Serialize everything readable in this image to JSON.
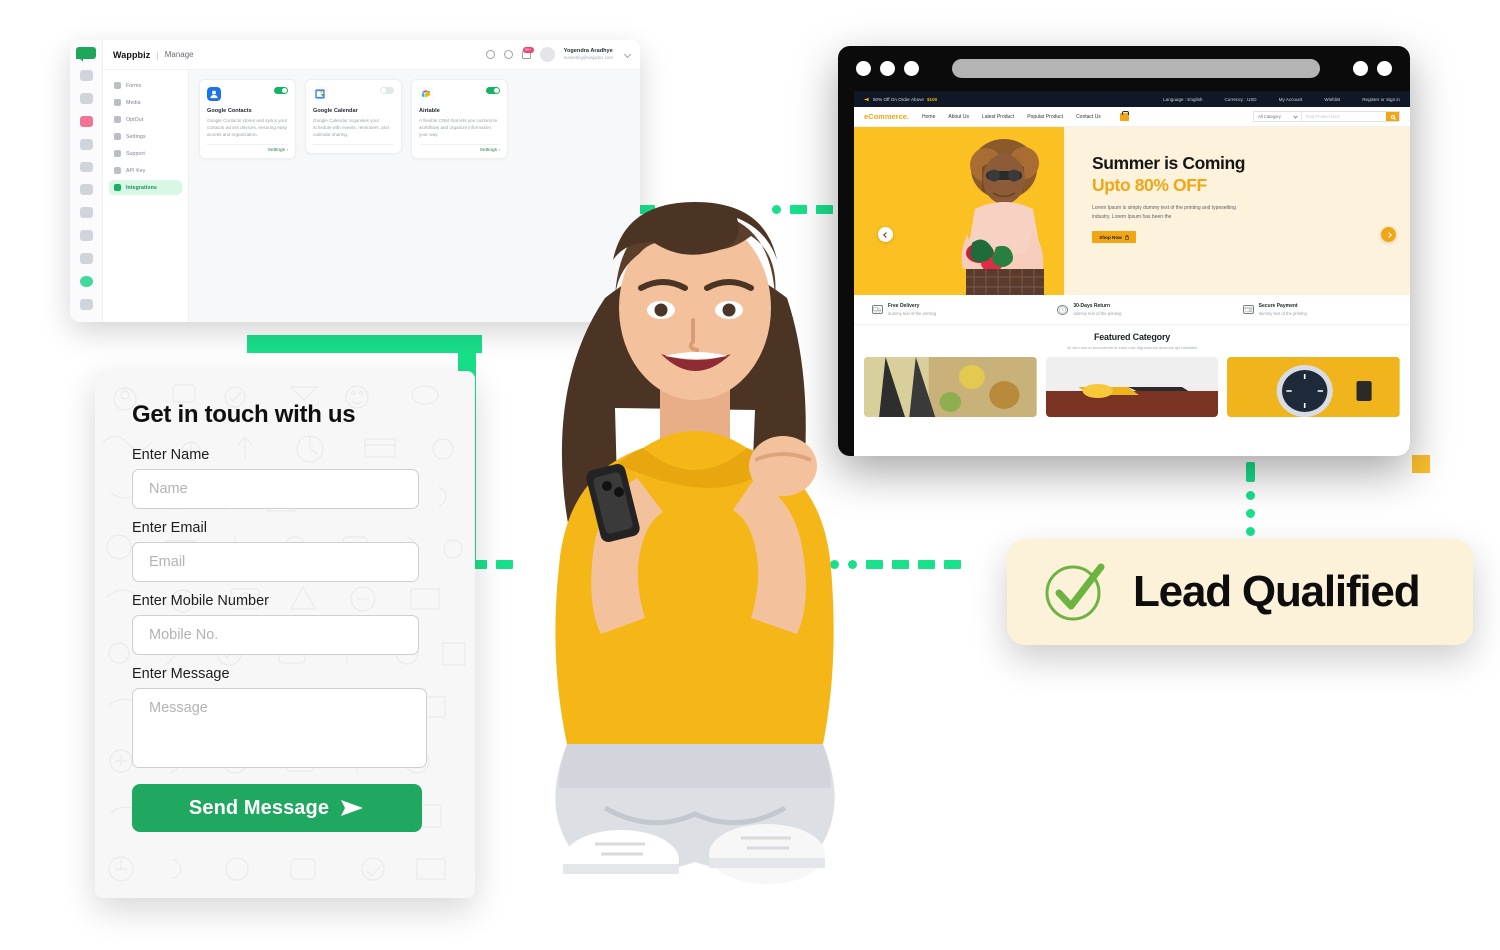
{
  "dashboard": {
    "brand": "Wappbiz",
    "separator": "|",
    "section": "Manage",
    "user": {
      "name": "Yogendra Aradhye",
      "email": "marketing@wappbiz.com",
      "notification_badge": "99+"
    },
    "sidebar": [
      {
        "label": "Forms",
        "active": false
      },
      {
        "label": "Media",
        "active": false
      },
      {
        "label": "OptOut",
        "active": false
      },
      {
        "label": "Settings",
        "active": false
      },
      {
        "label": "Support",
        "active": false
      },
      {
        "label": "API Key",
        "active": false
      },
      {
        "label": "Integrations",
        "active": true
      }
    ],
    "integration_cards": [
      {
        "title": "Google Contacts",
        "description": "Google Contacts stores and syncs your contacts across devices, ensuring easy access and organization.",
        "enabled": true,
        "settings_label": "Settings",
        "icon": "google-contacts-icon"
      },
      {
        "title": "Google Calendar",
        "description": "Google Calendar organises your schedule with events, reminders, and calendar sharing.",
        "enabled": false,
        "settings_label": "",
        "icon": "google-calendar-icon"
      },
      {
        "title": "Airtable",
        "description": "A flexible CRM that lets you customize workflows and organize information your way.",
        "enabled": true,
        "settings_label": "Settings",
        "icon": "airtable-icon"
      }
    ]
  },
  "contact_form": {
    "title": "Get in touch with us",
    "fields": [
      {
        "label": "Enter Name",
        "placeholder": "Name",
        "value": ""
      },
      {
        "label": "Enter Email",
        "placeholder": "Email",
        "value": ""
      },
      {
        "label": "Enter Mobile Number",
        "placeholder": "Mobile No.",
        "value": ""
      }
    ],
    "message": {
      "label": "Enter Message",
      "placeholder": "Message",
      "value": ""
    },
    "submit_label": "Send Message",
    "submit_icon": "send-plane-icon"
  },
  "ecommerce": {
    "topbar": {
      "promo": "50% Off On Order Above",
      "promo_amount": "$100",
      "language": "Language : English",
      "currency": "Currency : USD",
      "account": "My Account",
      "wishlist": "Wishlist",
      "signin": "Register or Sign in"
    },
    "nav": {
      "logo": "eCommerce.",
      "items": [
        "Home",
        "About Us",
        "Latest Product",
        "Popular Product",
        "Contact Us"
      ],
      "category_select": "All Category",
      "search_placeholder": "Find Product Here"
    },
    "hero": {
      "line1": "Summer is Coming",
      "line2": "Upto 80% OFF",
      "paragraph": "Lorem Ipsum is simply dummy text of the printing and typesetting industry. Lorem Ipsum has been the",
      "cta": "Shop Now"
    },
    "features": [
      {
        "title": "Free Delivery",
        "desc": "dummy text of the printing",
        "icon": "truck-icon"
      },
      {
        "title": "30-Days Return",
        "desc": "dummy text of the printing",
        "icon": "return-clock-icon"
      },
      {
        "title": "Secure Payment",
        "desc": "dummy text of the printing",
        "icon": "secure-card-icon"
      }
    ],
    "featured": {
      "heading": "Featured Category",
      "subheading": "At vero eos et accusamus et iusto odio dignissimos ducimus qui blanditiis"
    }
  },
  "lead_badge": {
    "text": "Lead Qualified",
    "icon": "check-circle-icon"
  },
  "colors": {
    "green": "#20a760",
    "accent_green": "#19e08a",
    "yellow": "#fbc122",
    "amber": "#f2a515",
    "cream": "#fcf2d9",
    "dark": "#0b0b0b"
  }
}
